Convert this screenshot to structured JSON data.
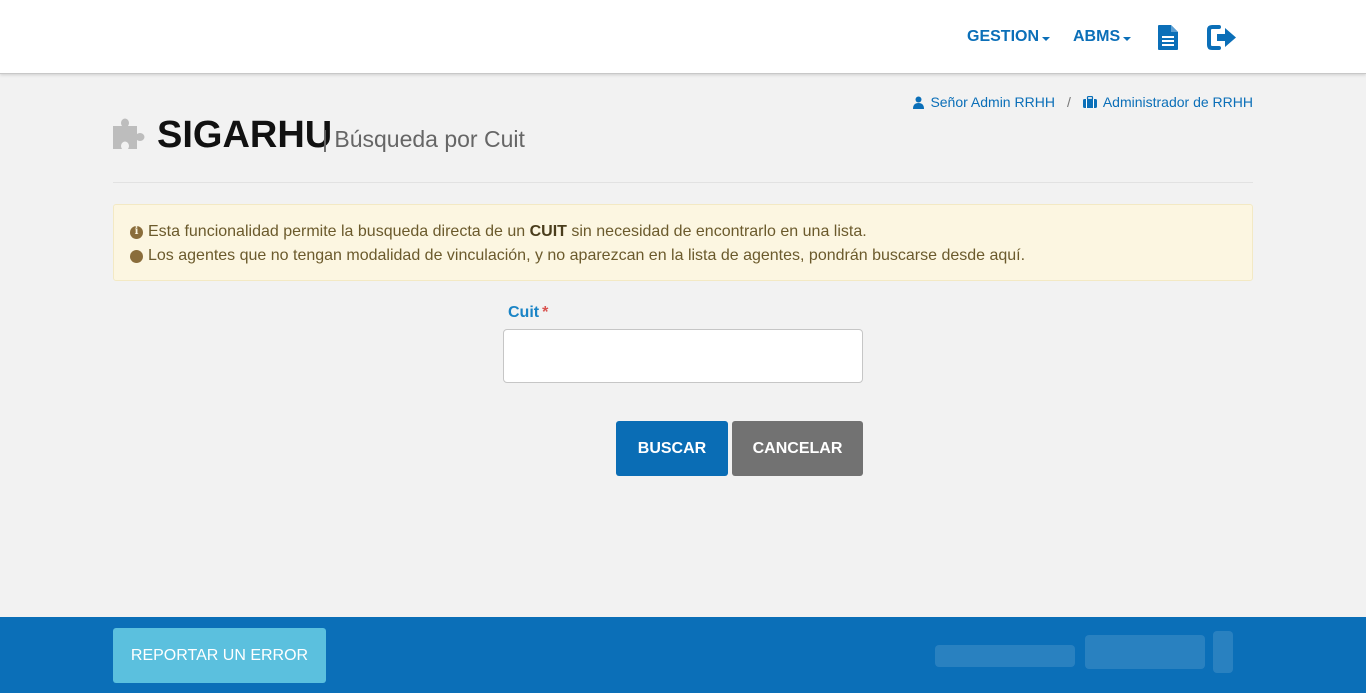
{
  "nav": {
    "items": [
      {
        "label": "GESTION"
      },
      {
        "label": "ABMS"
      }
    ],
    "icons": [
      "document-icon",
      "logout-icon"
    ],
    "accent_color": "#0b6fb8"
  },
  "user": {
    "name": "Señor Admin RRHH",
    "separator": "/",
    "role": "Administrador de RRHH"
  },
  "page": {
    "title": "SIGARHU",
    "subtitle": "| Búsqueda por Cuit"
  },
  "alert": {
    "line1_before": "Esta funcionalidad permite la busqueda directa de un ",
    "line1_bold": "CUIT",
    "line1_after": " sin necesidad de encontrarlo en una lista.",
    "line2": "Los agentes que no tengan modalidad de vinculación, y no aparezcan en la lista de agentes, pondrán buscarse desde aquí."
  },
  "form": {
    "cuit_label": "Cuit",
    "required_mark": "*",
    "cuit_value": ""
  },
  "buttons": {
    "search": "BUSCAR",
    "cancel": "CANCELAR",
    "report": "REPORTAR UN ERROR"
  },
  "colors": {
    "primary": "#0a6db5",
    "secondary": "#727272",
    "info": "#5bc0de",
    "footer": "#0b6fb8",
    "alert_bg": "#fcf6e1"
  }
}
